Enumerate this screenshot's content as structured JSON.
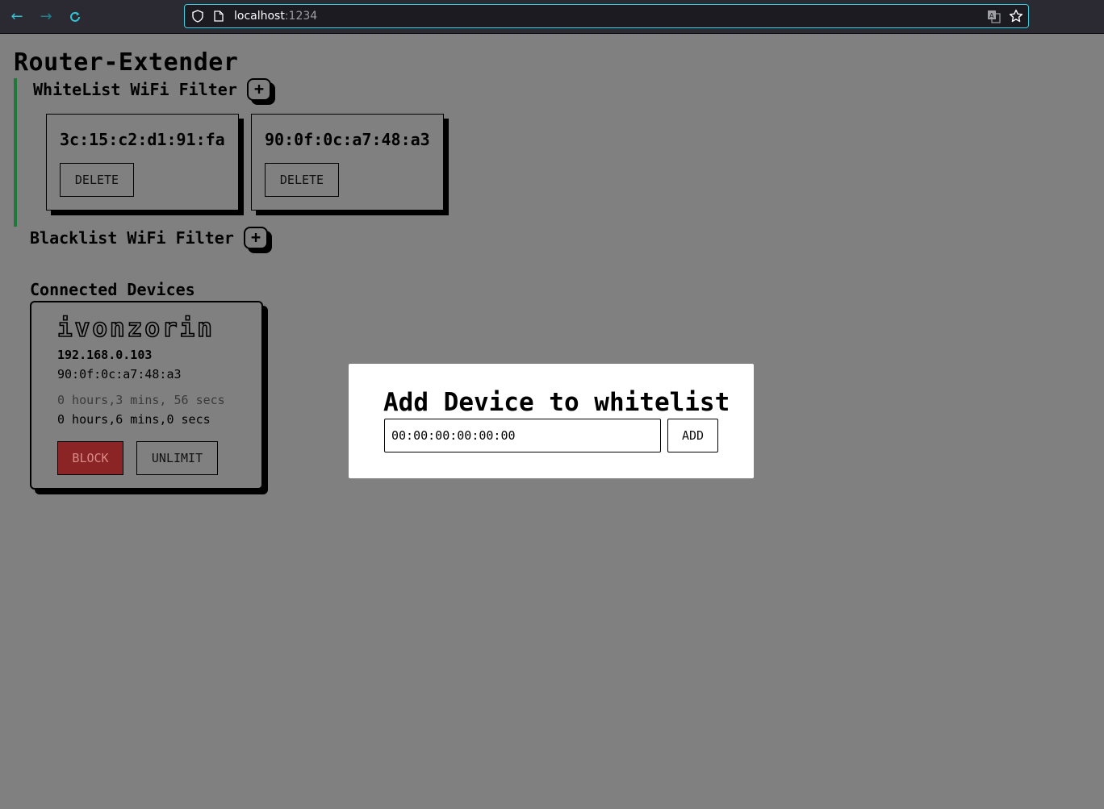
{
  "browser": {
    "url_host": "localhost",
    "url_port": ":1234"
  },
  "app": {
    "title": "Router-Extender"
  },
  "whitelist": {
    "title": "WhiteList WiFi Filter",
    "add_label": "+",
    "entries": [
      {
        "mac": "3c:15:c2:d1:91:fa",
        "delete_label": "DELETE"
      },
      {
        "mac": "90:0f:0c:a7:48:a3",
        "delete_label": "DELETE"
      }
    ],
    "accent_color": "#1e7a3a"
  },
  "blacklist": {
    "title": "Blacklist WiFi Filter",
    "add_label": "+"
  },
  "devices": {
    "title": "Connected Devices",
    "items": [
      {
        "name": "ivonzorin",
        "ip": "192.168.0.103",
        "mac": "90:0f:0c:a7:48:a3",
        "time_used": "0 hours,3 mins, 56 secs",
        "time_limit": "0 hours,6 mins,0 secs",
        "block_label": "BLOCK",
        "unlimit_label": "UNLIMIT"
      }
    ],
    "block_color": "#8b2424"
  },
  "modal": {
    "title": "Add Device to whitelist",
    "input_value": "00:00:00:00:00:00",
    "add_label": "ADD"
  }
}
